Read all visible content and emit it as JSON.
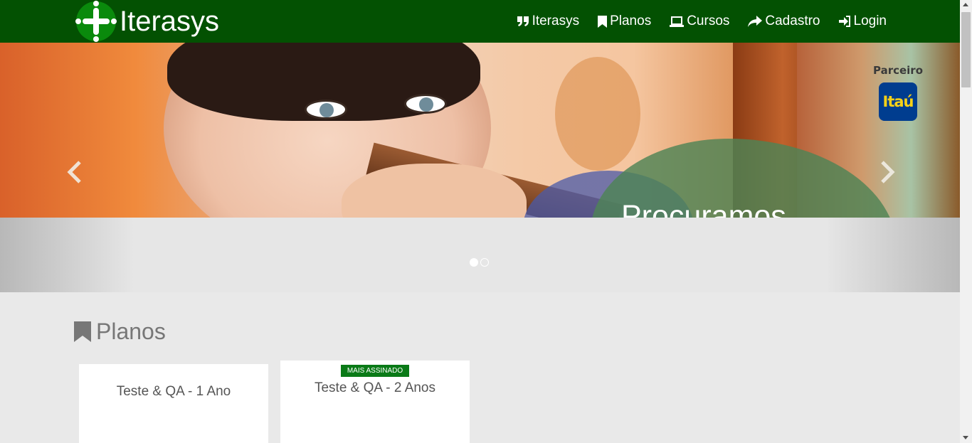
{
  "brand": {
    "name": "Iterasys"
  },
  "nav": {
    "items": [
      {
        "label": "Iterasys",
        "icon": "quote-icon"
      },
      {
        "label": "Planos",
        "icon": "bookmark-icon"
      },
      {
        "label": "Cursos",
        "icon": "laptop-icon"
      },
      {
        "label": "Cadastro",
        "icon": "share-icon"
      },
      {
        "label": "Login",
        "icon": "login-icon"
      }
    ]
  },
  "carousel": {
    "caption": "Procuramos",
    "partner_label": "Parceiro",
    "partner_logo_text": "Itaú",
    "slides_count": 2,
    "active_slide": 1
  },
  "plans": {
    "title": "Planos",
    "items": [
      {
        "name": "Teste & QA - 1 Ano",
        "badge": ""
      },
      {
        "name": "Teste & QA - 2 Anos",
        "badge": "MAIS ASSINADO"
      }
    ]
  },
  "colors": {
    "navbar": "#035102",
    "badge": "#0a7a17",
    "partner_logo_bg": "#003d8f",
    "partner_logo_text": "#f7d117"
  }
}
